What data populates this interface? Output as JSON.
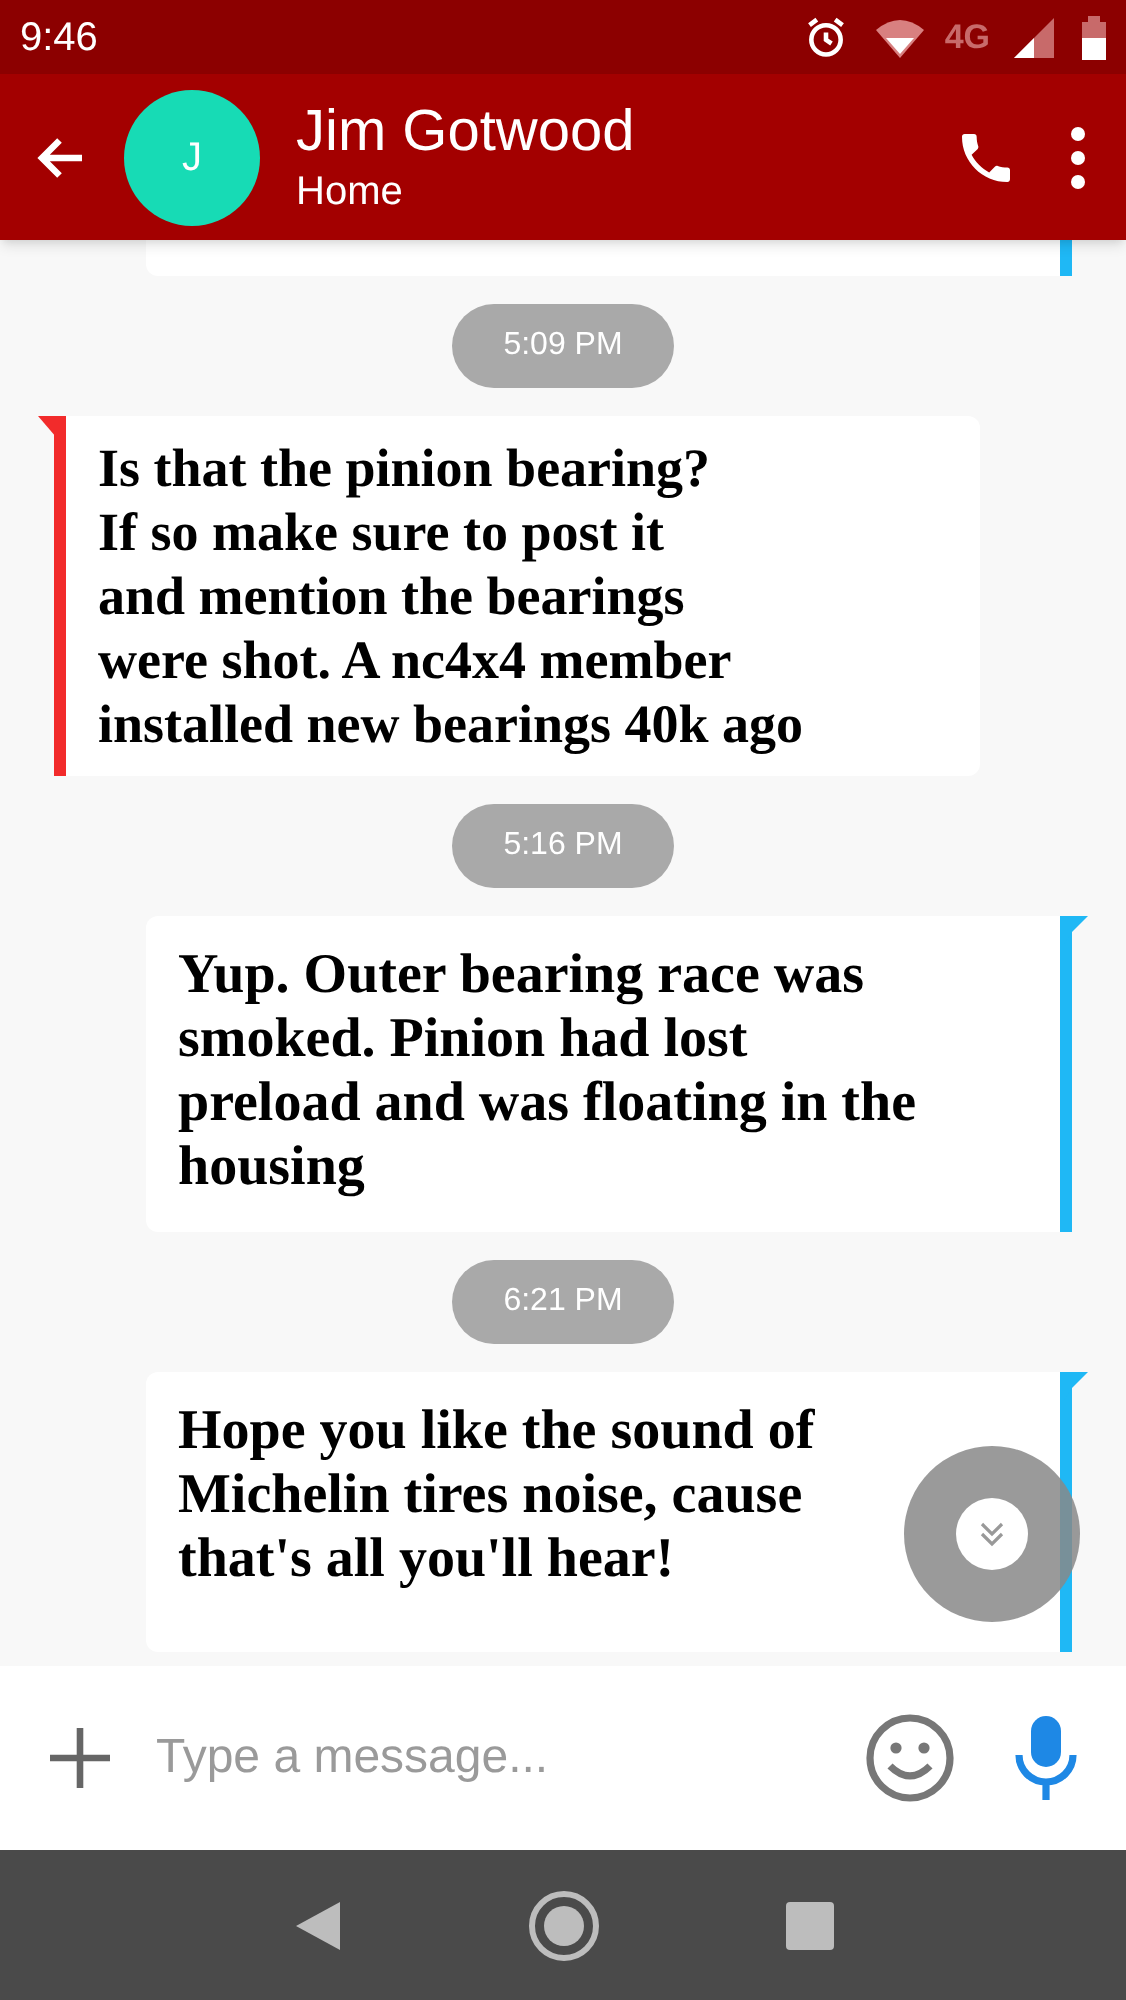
{
  "status_bar": {
    "time": "9:46",
    "network": "4G"
  },
  "header": {
    "avatar_letter": "J",
    "name": "Jim Gotwood",
    "subtitle": "Home"
  },
  "messages": [
    {
      "kind": "outgoing_partial"
    },
    {
      "kind": "time",
      "text": "5:09 PM"
    },
    {
      "kind": "incoming",
      "text": "Is that the pinion bearing?\nIf so make sure to post it\nand mention the bearings\nwere shot.  A nc4x4 member\ninstalled new bearings 40k ago"
    },
    {
      "kind": "time",
      "text": "5:16 PM"
    },
    {
      "kind": "outgoing",
      "text": "Yup. Outer bearing race was\nsmoked. Pinion had lost\npreload and was floating in the\nhousing"
    },
    {
      "kind": "time",
      "text": "6:21 PM"
    },
    {
      "kind": "outgoing",
      "text": "Hope you like the sound of\nMichelin tires noise, cause\nthat's all you'll hear!"
    }
  ],
  "composer": {
    "placeholder": "Type a message..."
  }
}
